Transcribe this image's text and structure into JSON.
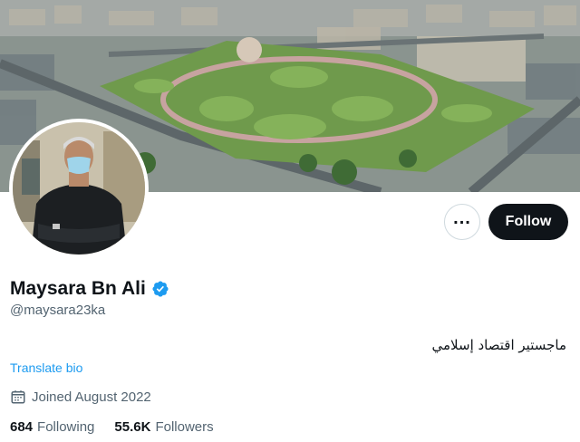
{
  "profile": {
    "display_name": "Maysara Bn Ali",
    "handle": "@maysara23ka",
    "bio": "ماجستير اقتصاد إسلامي",
    "translate_label": "Translate bio",
    "joined": "Joined August 2022",
    "following_count": "684",
    "following_label": "Following",
    "followers_count": "55.6K",
    "followers_label": "Followers"
  },
  "actions": {
    "more_glyph": "...",
    "follow_label": "Follow"
  },
  "icons": {
    "verified": "verified-badge-icon",
    "calendar": "calendar-icon",
    "more": "more-horizontal-icon"
  },
  "colors": {
    "accent": "#1d9bf0",
    "follow_bg": "#0f1419",
    "muted_text": "#536471"
  }
}
